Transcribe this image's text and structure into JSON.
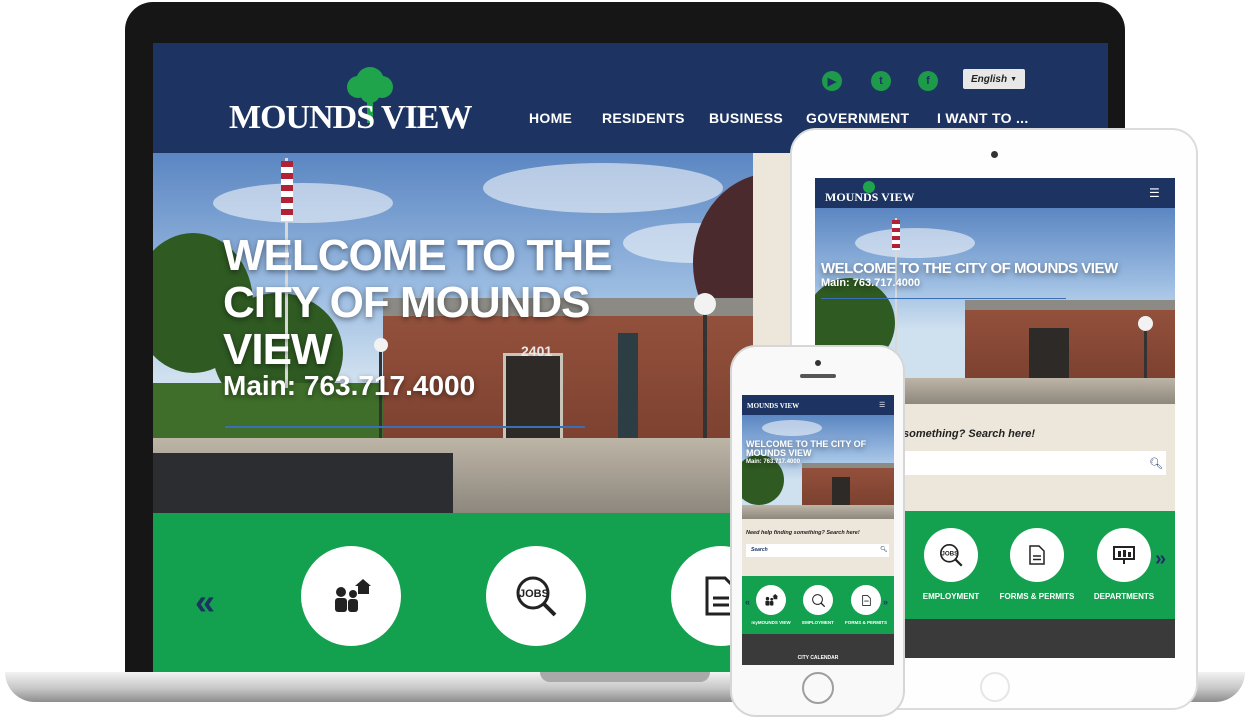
{
  "laptop": {
    "logo_text": "MOUNDS VIEW",
    "nav": [
      "HOME",
      "RESIDENTS",
      "BUSINESS",
      "GOVERNMENT",
      "I WANT TO ..."
    ],
    "social_icons": [
      "youtube-icon",
      "twitter-icon",
      "facebook-icon"
    ],
    "language": "English",
    "hero_title": [
      "WELCOME TO THE",
      "CITY OF MOUNDS",
      "VIEW"
    ],
    "hero_phone": "Main: 763.717.4000",
    "building_number": "2401",
    "quick_links_icons": [
      "home-family-icon",
      "jobs-search-icon",
      "document-icon"
    ],
    "prev_arrow": "«"
  },
  "tablet": {
    "logo_text": "MOUNDS VIEW",
    "menu_icon": "☰",
    "hero_title": "WELCOME TO THE CITY OF MOUNDS VIEW",
    "hero_phone": "Main: 763.717.4000",
    "search_prompt": "something? Search here!",
    "quick_links": [
      {
        "icon": "jobs-search-icon",
        "label": "EMPLOYMENT"
      },
      {
        "icon": "document-icon",
        "label": "FORMS & PERMITS"
      },
      {
        "icon": "departments-icon",
        "label": "DEPARTMENTS"
      }
    ],
    "next_arrow": "»"
  },
  "phone": {
    "logo_text": "MOUNDS VIEW",
    "hero_title": "WELCOME TO THE CITY OF MOUNDS VIEW",
    "hero_phone": "Main: 763.717.4000",
    "search_prompt": "Need help finding something? Search here!",
    "search_placeholder": "Search",
    "quick_links": [
      {
        "icon": "home-family-icon",
        "label": "myMOUNDS VIEW"
      },
      {
        "icon": "jobs-search-icon",
        "label": "EMPLOYMENT"
      },
      {
        "icon": "document-icon",
        "label": "FORMS & PERMITS"
      }
    ],
    "footer_label": "CITY CALENDAR"
  },
  "colors": {
    "navy": "#1d3463",
    "green": "#13a150",
    "beige": "#ede6da"
  }
}
